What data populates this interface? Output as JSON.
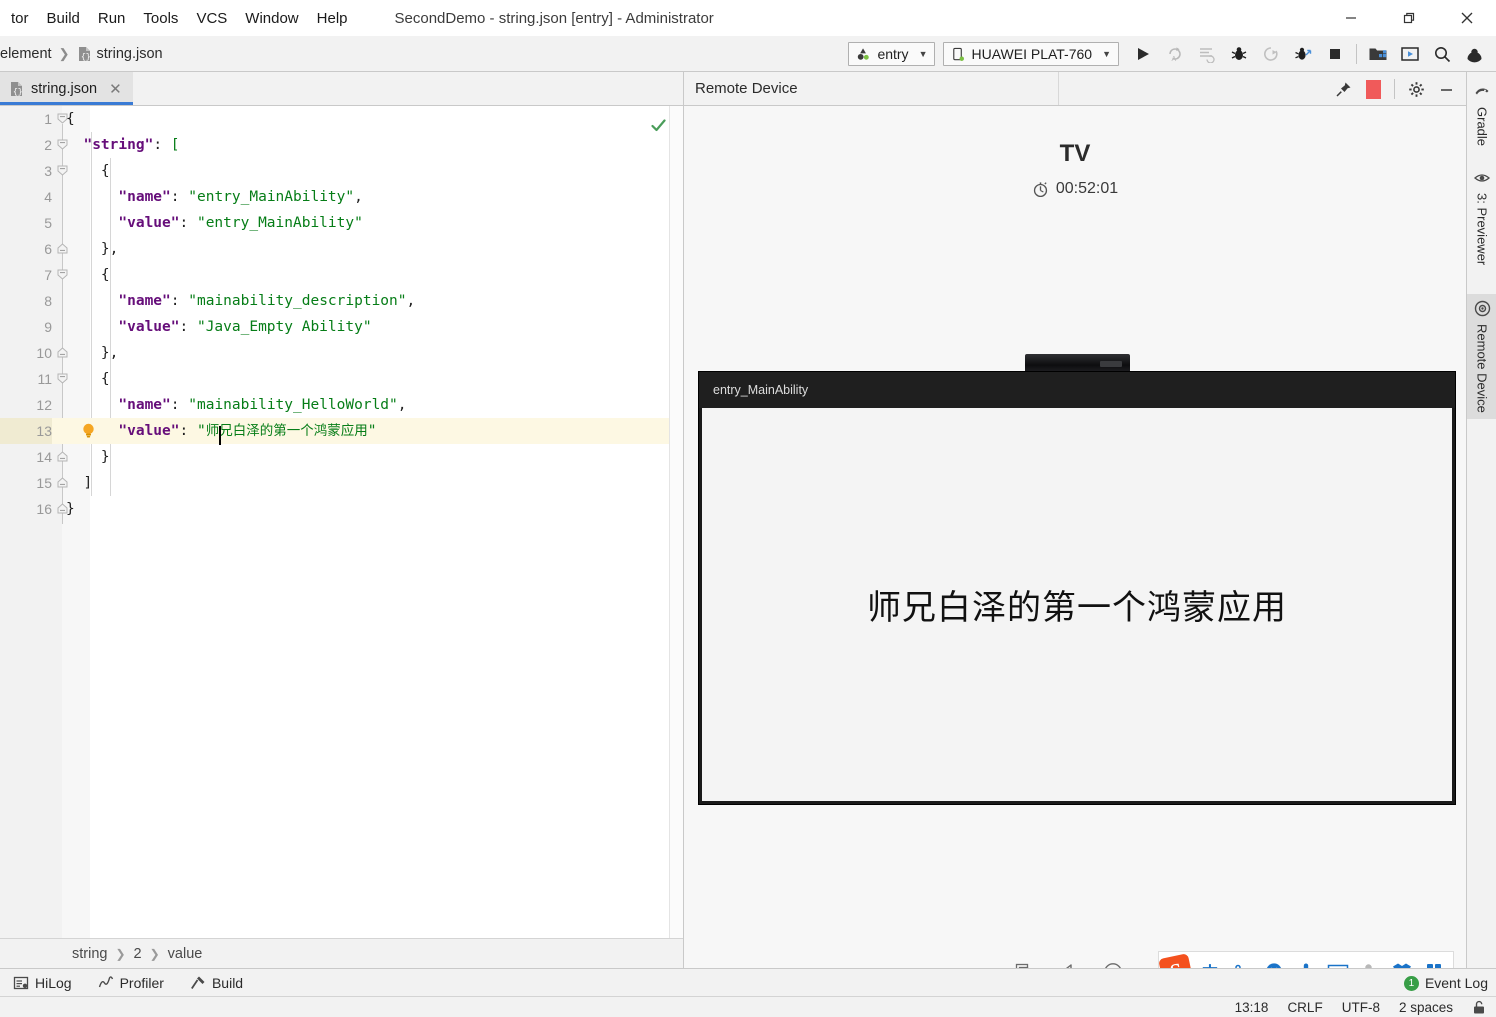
{
  "window": {
    "title": "SecondDemo - string.json [entry] - Administrator",
    "menu": [
      "tor",
      "Build",
      "Run",
      "Tools",
      "VCS",
      "Window",
      "Help"
    ],
    "controls": {
      "minimize": "minimize-icon",
      "restore": "restore-icon",
      "close": "close-icon"
    }
  },
  "navbar": {
    "breadcrumb": [
      "element",
      "string.json"
    ],
    "module_combo": "entry",
    "device_combo": "HUAWEI PLAT-760",
    "actions": [
      "run-icon",
      "rerun-icon",
      "apply-changes-icon",
      "debug-icon",
      "attach-debugger-icon",
      "profile-icon",
      "stop-icon",
      "sdk-manager-icon",
      "device-manager-icon",
      "search-icon",
      "account-icon"
    ]
  },
  "editor": {
    "tab": {
      "label": "string.json",
      "close": "close-tab-icon"
    },
    "inspection_status": "ok-check-icon",
    "breadcrumb": [
      "string",
      "2",
      "value"
    ],
    "lines": [
      {
        "n": "1",
        "html": "{"
      },
      {
        "n": "2",
        "html": "  \"string\": ["
      },
      {
        "n": "3",
        "html": "    {"
      },
      {
        "n": "4",
        "html": "      \"name\": \"entry_MainAbility\","
      },
      {
        "n": "5",
        "html": "      \"value\": \"entry_MainAbility\""
      },
      {
        "n": "6",
        "html": "    },"
      },
      {
        "n": "7",
        "html": "    {"
      },
      {
        "n": "8",
        "html": "      \"name\": \"mainability_description\","
      },
      {
        "n": "9",
        "html": "      \"value\": \"Java_Empty Ability\""
      },
      {
        "n": "10",
        "html": "    },"
      },
      {
        "n": "11",
        "html": "    {"
      },
      {
        "n": "12",
        "html": "      \"name\": \"mainability_HelloWorld\","
      },
      {
        "n": "13",
        "html": "      \"value\": \"师兄白泽的第一个鸿蒙应用\""
      },
      {
        "n": "14",
        "html": "    }"
      },
      {
        "n": "15",
        "html": "  ]"
      },
      {
        "n": "16",
        "html": "}"
      }
    ],
    "highlighted_line": 13,
    "intention_bulb": "lightbulb-icon"
  },
  "remote_device": {
    "panel_title": "Remote Device",
    "actions": [
      "pin-icon",
      "stop-icon",
      "settings-gear-icon",
      "minimize-icon"
    ],
    "device_label": "TV",
    "session_timer": "00:52:01",
    "timer_icon": "stopwatch-icon",
    "screen": {
      "app_titlebar": "entry_MainAbility",
      "app_text": "师兄白泽的第一个鸿蒙应用"
    },
    "nav_buttons": [
      "recent-apps-icon",
      "back-icon",
      "home-icon"
    ],
    "ime": {
      "logo": "sogou-logo-icon",
      "items": [
        "chinese-mode-icon",
        "punctuation-icon",
        "emoji-icon",
        "voice-input-icon",
        "keyboard-icon",
        "user-icon",
        "skin-icon",
        "apps-icon"
      ],
      "chinese_label": "中"
    }
  },
  "right_tool_strip": [
    {
      "label": "Gradle",
      "icon": "gradle-elephant-icon",
      "selected": false
    },
    {
      "label": "3: Previewer",
      "icon": "eye-icon",
      "selected": false
    },
    {
      "label": "Remote Device",
      "icon": "remote-device-icon",
      "selected": true
    }
  ],
  "bottom_bar": {
    "buttons": [
      {
        "label": "HiLog",
        "icon": "hilog-icon"
      },
      {
        "label": "Profiler",
        "icon": "profiler-icon"
      },
      {
        "label": "Build",
        "icon": "build-hammer-icon"
      }
    ],
    "event_log": {
      "label": "Event Log",
      "count": "1"
    }
  },
  "status_bar": {
    "position": "13:18",
    "line_separator": "CRLF",
    "encoding": "UTF-8",
    "indent": "2 spaces",
    "lock": "lock-icon"
  },
  "colors": {
    "accent_blue": "#3a7bd5",
    "json_key": "#660e7a",
    "json_value": "#067d17",
    "highlight_row": "#fdf8e3",
    "stop_red": "#f05a5a",
    "badge_green": "#389e47",
    "sogou_orange": "#f4511e",
    "ime_blue": "#1a73c8"
  }
}
